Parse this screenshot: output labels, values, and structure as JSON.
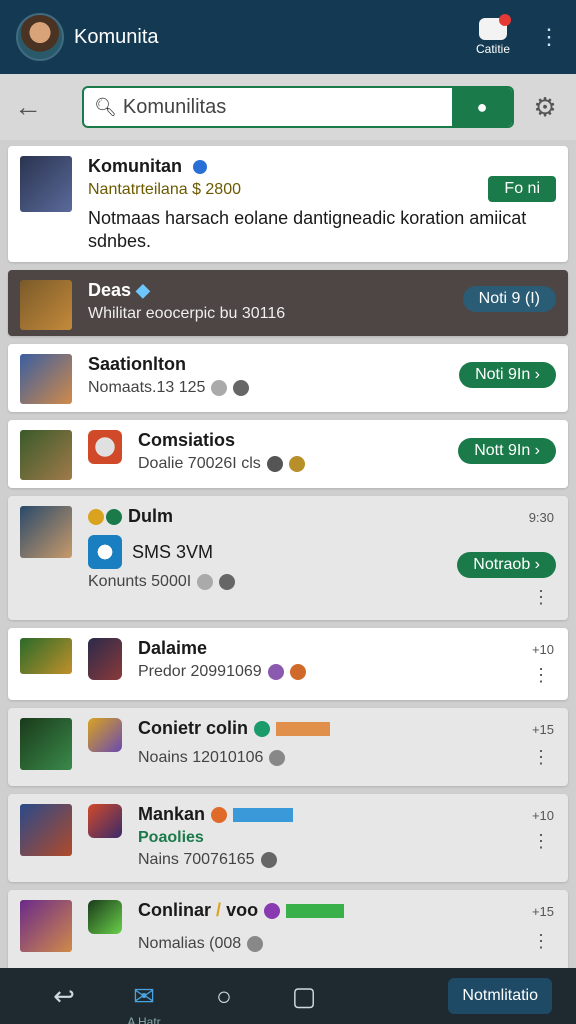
{
  "appbar": {
    "title": "Komunita",
    "cart_label": "Catitie"
  },
  "search": {
    "value": "Komunilitas"
  },
  "items": [
    {
      "name": "Komunitan",
      "meta": "Nantatrteilana $ 2800",
      "desc": "Notmaas harsach eolane dantigneadic koration amiicat sdnbes.",
      "button": "Fo ni"
    },
    {
      "name": "Deas",
      "meta": "Whilitar eoocerpic bu 30116",
      "button": "Noti 9 (I)"
    },
    {
      "name": "Saationlton",
      "meta": "Nomaats.13 125",
      "button": "Noti 9In"
    },
    {
      "name": "Comsiatios",
      "meta": "Doalie 70026I cls",
      "button": "Nott 9In"
    },
    {
      "name": "Dulm",
      "time": "9:30",
      "sub_name": "SMS 3VM",
      "meta": "Konunts 5000I",
      "button": "Notraob"
    },
    {
      "name": "Dalaime",
      "time": "+10",
      "meta": "Predor 20991069"
    },
    {
      "name": "Conietr colin",
      "time": "+15",
      "meta": "Noains 12010106"
    },
    {
      "name": "Mankan",
      "time": "+10",
      "sub_name": "Poaolies",
      "meta": "Nains 70076165"
    },
    {
      "name": "Conlinar",
      "tag_text": "voo",
      "time": "+15",
      "meta": "Nomalias (008"
    }
  ],
  "bottomnav": {
    "mail_label": "A Hatr",
    "notif_label": "Notmlitatio"
  },
  "colors": {
    "appbar": "#133a52",
    "accent_green": "#1b7a4a",
    "accent_blue": "#2a5c75"
  }
}
